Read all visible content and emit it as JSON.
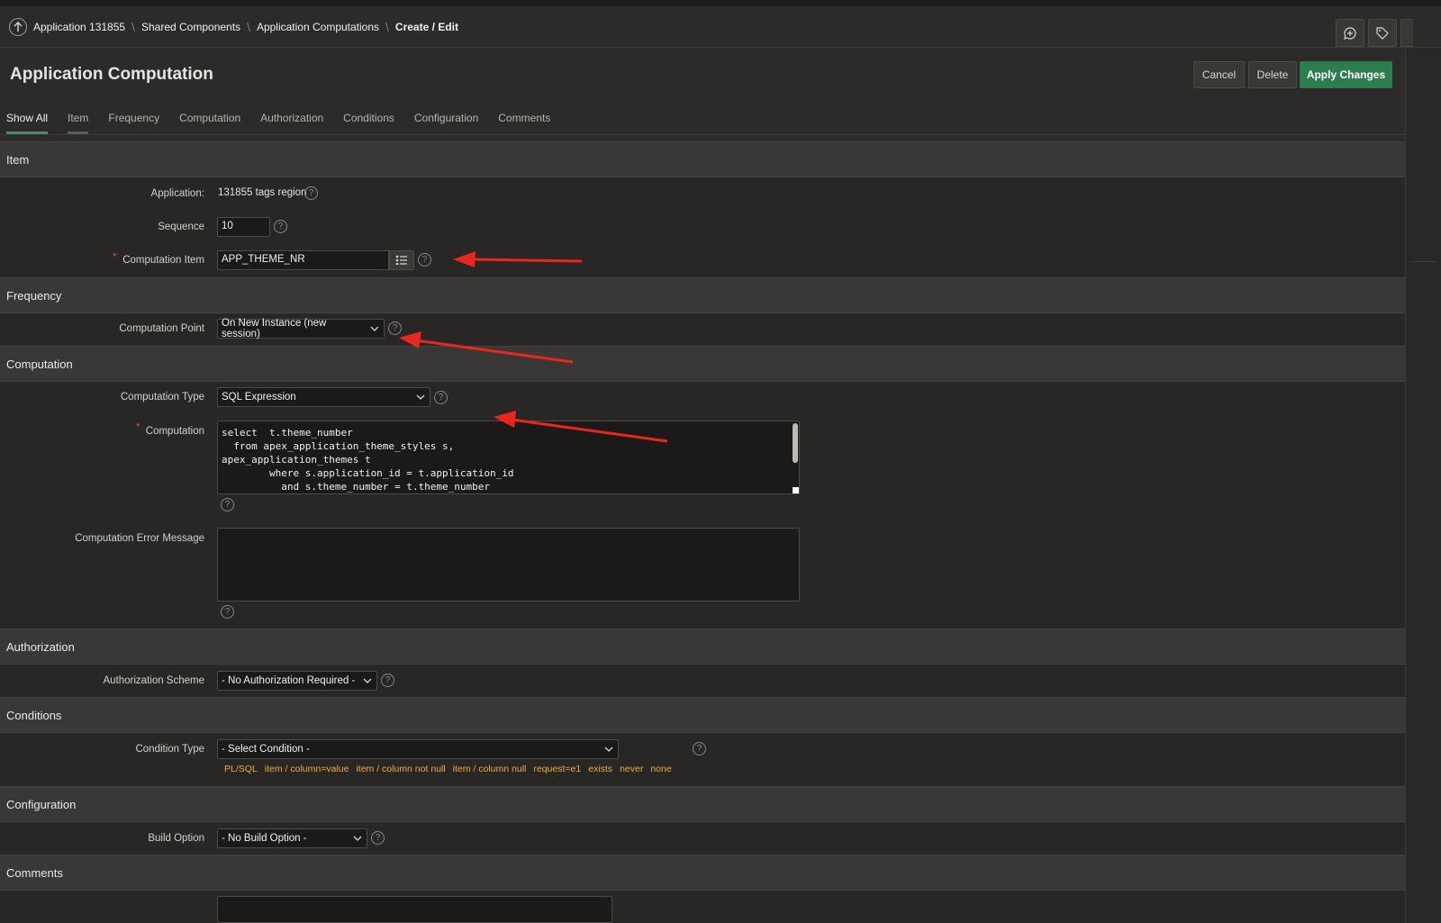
{
  "breadcrumb": {
    "items": [
      "Application 131855",
      "Shared Components",
      "Application Computations",
      "Create / Edit"
    ]
  },
  "page": {
    "title": "Application Computation",
    "cancel_label": "Cancel",
    "delete_label": "Delete",
    "apply_label": "Apply Changes"
  },
  "tabs": [
    "Show All",
    "Item",
    "Frequency",
    "Computation",
    "Authorization",
    "Conditions",
    "Configuration",
    "Comments"
  ],
  "sections": {
    "item": "Item",
    "frequency": "Frequency",
    "computation": "Computation",
    "authorization": "Authorization",
    "conditions": "Conditions",
    "configuration": "Configuration",
    "comments": "Comments"
  },
  "fields": {
    "application_label": "Application:",
    "application_value": "131855 tags region",
    "sequence_label": "Sequence",
    "sequence_value": "10",
    "computation_item_label": "Computation Item",
    "computation_item_value": "APP_THEME_NR",
    "computation_point_label": "Computation Point",
    "computation_point_value": "On New Instance (new session)",
    "computation_type_label": "Computation Type",
    "computation_type_value": "SQL Expression",
    "computation_label": "Computation",
    "computation_code": "select  t.theme_number\n  from apex_application_theme_styles s,\napex_application_themes t\n        where s.application_id = t.application_id\n          and s.theme_number = t.theme_number",
    "error_message_label": "Computation Error Message",
    "authorization_scheme_label": "Authorization Scheme",
    "authorization_scheme_value": "- No Authorization Required -",
    "condition_type_label": "Condition Type",
    "condition_type_value": "- Select Condition -",
    "condition_shortcuts": [
      "PL/SQL",
      "item / column=value",
      "item / column not null",
      "item / column null",
      "request=e1",
      "exists",
      "never",
      "none"
    ],
    "build_option_label": "Build Option",
    "build_option_value": "- No Build Option -"
  },
  "colors": {
    "primary_button": "#2e7d4f",
    "annotation_arrow": "#e8281f",
    "shortcut_link": "#f0a93e",
    "required_marker": "#e0483c"
  }
}
